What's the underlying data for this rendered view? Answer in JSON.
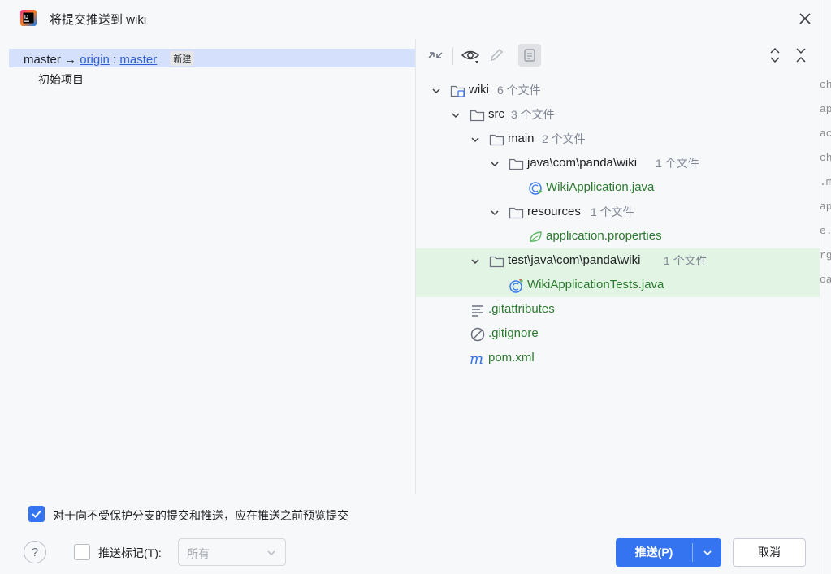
{
  "window": {
    "title": "将提交推送到 wiki"
  },
  "left_panel": {
    "branch": {
      "local": "master",
      "arrow": "→",
      "remote": "origin",
      "sep": ":",
      "remote_branch": "master",
      "badge": "新建"
    },
    "commit": "初始项目"
  },
  "toolbar": {
    "buttons": [
      "collapse-diff-icon",
      "eye-icon",
      "edit-icon",
      "preview-icon",
      "expand-all-icon",
      "collapse-all-icon"
    ]
  },
  "tree": [
    {
      "name": "wiki",
      "count": "6 个文件",
      "type": "module"
    },
    {
      "name": "src",
      "count": "3 个文件",
      "type": "folder"
    },
    {
      "name": "main",
      "count": "2 个文件",
      "type": "folder"
    },
    {
      "name": "java\\com\\panda\\wiki",
      "count": "1 个文件",
      "type": "folder"
    },
    {
      "name": "WikiApplication.java",
      "count": "",
      "type": "java-app"
    },
    {
      "name": "resources",
      "count": "1 个文件",
      "type": "folder"
    },
    {
      "name": "application.properties",
      "count": "",
      "type": "spring"
    },
    {
      "name": "test\\java\\com\\panda\\wiki",
      "count": "1 个文件",
      "type": "folder"
    },
    {
      "name": "WikiApplicationTests.java",
      "count": "",
      "type": "java-test"
    },
    {
      "name": ".gitattributes",
      "count": "",
      "type": "text"
    },
    {
      "name": ".gitignore",
      "count": "",
      "type": "ignore"
    },
    {
      "name": "pom.xml",
      "count": "",
      "type": "maven"
    }
  ],
  "footer": {
    "preview_checkbox_label": "对于向不受保护分支的提交和推送，应在推送之前预览提交",
    "preview_checked": true,
    "help": "?",
    "tag_label": "推送标记(T):",
    "tag_checked": false,
    "tag_option": "所有",
    "push_label": "推送(P)",
    "cancel_label": "取消"
  },
  "background_fragments": [
    "che",
    "ap",
    "ac",
    "ch",
    ".m",
    "ap",
    "e.",
    "rg",
    "oa"
  ],
  "colors": {
    "accent": "#3574f0",
    "new_file_green": "#2c7a2f",
    "highlight_row": "#e2f4e4",
    "selection": "#d5e1fc"
  }
}
